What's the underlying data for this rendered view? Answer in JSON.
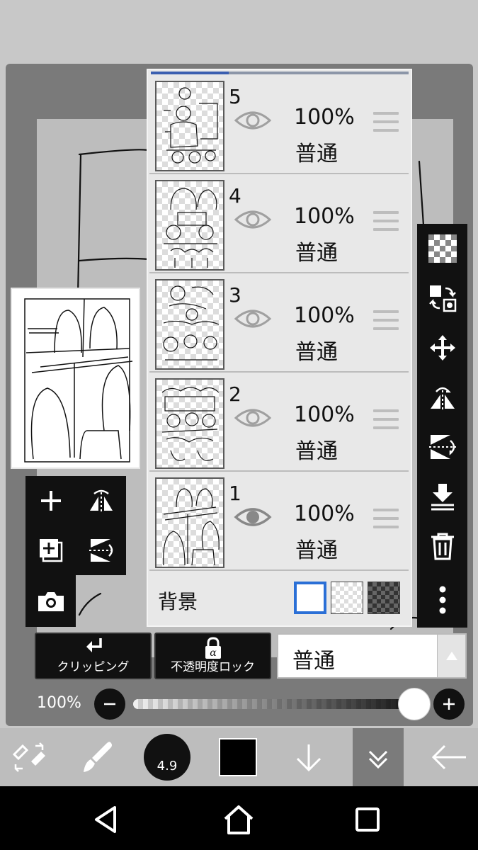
{
  "layers": [
    {
      "number": "5",
      "opacity": "100%",
      "blend": "普通",
      "visible": true
    },
    {
      "number": "4",
      "opacity": "100%",
      "blend": "普通",
      "visible": true
    },
    {
      "number": "3",
      "opacity": "100%",
      "blend": "普通",
      "visible": true
    },
    {
      "number": "2",
      "opacity": "100%",
      "blend": "普通",
      "visible": true
    },
    {
      "number": "1",
      "opacity": "100%",
      "blend": "普通",
      "visible": true,
      "selected": true
    }
  ],
  "background": {
    "label": "背景",
    "options": [
      "white",
      "transparent",
      "dark-checker"
    ],
    "selected": "white"
  },
  "mode_buttons": {
    "clipping": "クリッピング",
    "alpha_lock": "不透明度ロック"
  },
  "blend_mode": {
    "value": "普通"
  },
  "opacity": {
    "label": "100%",
    "value": 100
  },
  "brush": {
    "size": "4.9"
  },
  "colors": {
    "primary": "#000000",
    "selected_border": "#2a6fd6"
  },
  "icons": {
    "left_tools": [
      "add-layer-icon",
      "flip-horizontal-icon",
      "duplicate-layer-icon",
      "flip-vertical-icon",
      "camera-icon"
    ],
    "right_tools": [
      "checker-icon",
      "swap-layer-icon",
      "move-icon",
      "flip-horizontal-icon",
      "flip-vertical-icon",
      "merge-down-icon",
      "trash-icon",
      "more-icon"
    ],
    "bottom_bar": [
      "tool-switch-icon",
      "brush-icon",
      "brush-size",
      "color-swatch",
      "down-arrow-icon",
      "layers-collapse-icon",
      "back-arrow-icon"
    ],
    "nav_bar": [
      "back-icon",
      "home-icon",
      "recents-icon"
    ]
  }
}
